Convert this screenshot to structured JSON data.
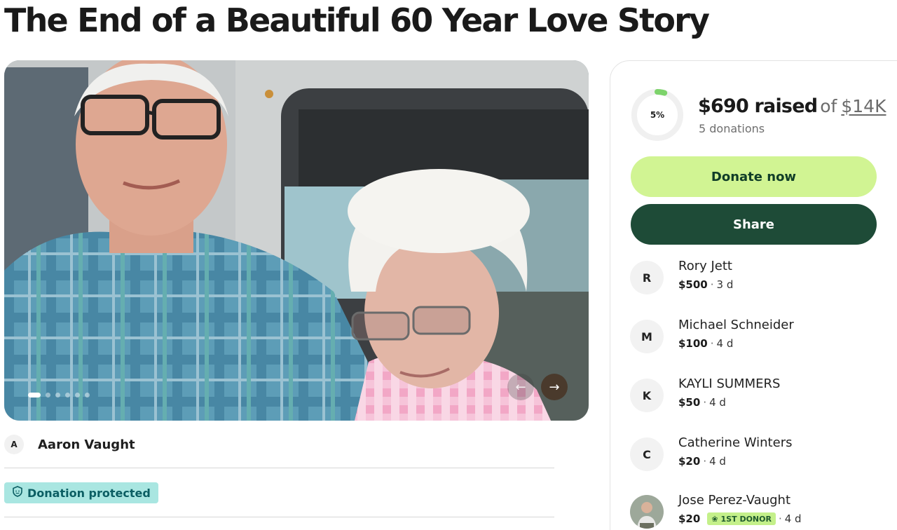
{
  "campaign": {
    "title": "The End of a Beautiful 60 Year Love Story"
  },
  "gallery": {
    "slide_count": 6,
    "active_slide": 1,
    "prev_icon": "arrow-left-icon",
    "next_icon": "arrow-right-icon"
  },
  "organizer": {
    "initial": "A",
    "name": "Aaron Vaught"
  },
  "protection": {
    "label": "Donation protected",
    "icon": "shield-icon",
    "color": "#a9e6e1"
  },
  "progress": {
    "percent_label": "5%",
    "percent": 5,
    "raised": "$690 raised",
    "of": "of",
    "goal": "$14K",
    "donations": "5 donations"
  },
  "actions": {
    "donate_label": "Donate now",
    "share_label": "Share",
    "donate_color": "#d1f493",
    "share_color": "#1e4b37"
  },
  "donors": [
    {
      "initial": "R",
      "name": "Rory Jett",
      "amount": "$500",
      "time": "3 d"
    },
    {
      "initial": "M",
      "name": "Michael Schneider",
      "amount": "$100",
      "time": "4 d"
    },
    {
      "initial": "K",
      "name": "KAYLI SUMMERS",
      "amount": "$50",
      "time": "4 d"
    },
    {
      "initial": "C",
      "name": "Catherine Winters",
      "amount": "$20",
      "time": "4 d"
    },
    {
      "initial": "",
      "name": "Jose Perez-Vaught",
      "amount": "$20",
      "badge": "1ST DONOR",
      "time": "4 d"
    }
  ]
}
